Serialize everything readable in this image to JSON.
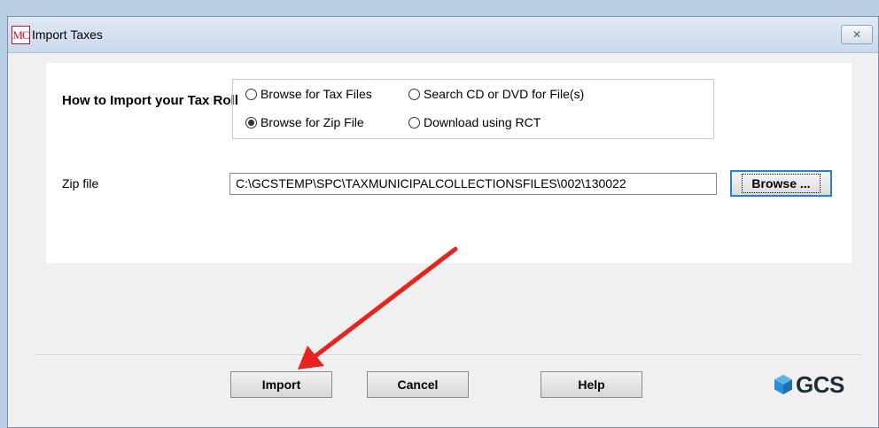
{
  "window": {
    "title": "Import Taxes",
    "app_icon_text": "MC",
    "close_glyph": "✕"
  },
  "import_section": {
    "label": "How to Import your Tax Roll",
    "options": [
      {
        "label": "Browse for Tax Files",
        "selected": false
      },
      {
        "label": "Search CD or DVD for File(s)",
        "selected": false
      },
      {
        "label": "Browse for Zip File",
        "selected": true
      },
      {
        "label": "Download using RCT",
        "selected": false
      }
    ]
  },
  "zip": {
    "label": "Zip file",
    "value": "C:\\GCSTEMP\\SPC\\TAXMUNICIPALCOLLECTIONSFILES\\002\\130022",
    "browse_label": "Browse ..."
  },
  "footer": {
    "import_label": "Import",
    "cancel_label": "Cancel",
    "help_label": "Help",
    "logo_text": "GCS",
    "logo_icon": "gcs-hexagon-icon"
  },
  "colors": {
    "annotation_arrow": "#e8231f",
    "focus_border": "#2b7fcf",
    "logo_blue": "#2a8fd6"
  }
}
